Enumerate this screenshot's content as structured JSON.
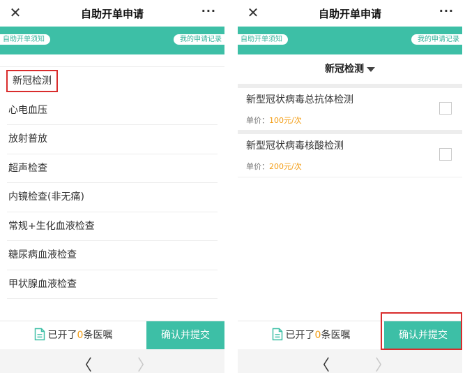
{
  "window": {
    "title": "自助开单申请",
    "close_icon": "close-icon",
    "more_icon": "more-icon",
    "more_glyph": "···"
  },
  "nav": {
    "left_pill": "自助开单须知",
    "right_pill": "我的申请记录"
  },
  "categories": [
    "新冠检测",
    "心电血压",
    "放射普放",
    "超声检查",
    "内镜检查(非无痛)",
    "常规+生化血液检查",
    "糖尿病血液检查",
    "甲状腺血液检查"
  ],
  "detail": {
    "selected_category": "新冠检测",
    "price_label": "单价：",
    "items": [
      {
        "name": "新型冠状病毒总抗体检测",
        "price": "100元/次"
      },
      {
        "name": "新型冠状病毒核酸检测",
        "price": "200元/次"
      }
    ]
  },
  "footer": {
    "order_prefix": "已开了",
    "order_count": "0",
    "order_suffix": "条医嘱",
    "confirm_label": "确认并提交"
  },
  "browser": {
    "back_glyph": "〈",
    "forward_glyph": "〉"
  },
  "colors": {
    "accent": "#3dbfa6",
    "price": "#f39c12",
    "highlight": "#d92c2c"
  }
}
